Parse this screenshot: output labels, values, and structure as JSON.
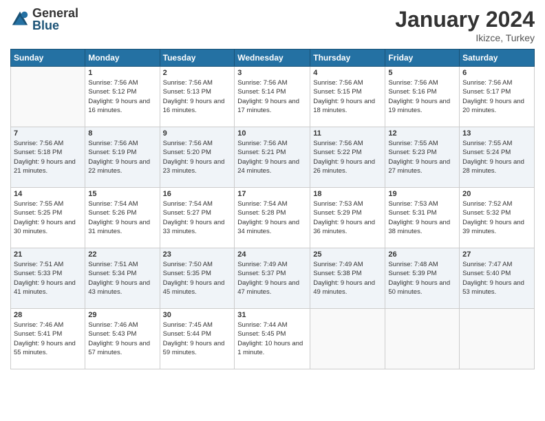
{
  "logo": {
    "general": "General",
    "blue": "Blue"
  },
  "header": {
    "title": "January 2024",
    "location": "Ikizce, Turkey"
  },
  "weekdays": [
    "Sunday",
    "Monday",
    "Tuesday",
    "Wednesday",
    "Thursday",
    "Friday",
    "Saturday"
  ],
  "weeks": [
    [
      {
        "day": "",
        "sunrise": "",
        "sunset": "",
        "daylight": ""
      },
      {
        "day": "1",
        "sunrise": "Sunrise: 7:56 AM",
        "sunset": "Sunset: 5:12 PM",
        "daylight": "Daylight: 9 hours and 16 minutes."
      },
      {
        "day": "2",
        "sunrise": "Sunrise: 7:56 AM",
        "sunset": "Sunset: 5:13 PM",
        "daylight": "Daylight: 9 hours and 16 minutes."
      },
      {
        "day": "3",
        "sunrise": "Sunrise: 7:56 AM",
        "sunset": "Sunset: 5:14 PM",
        "daylight": "Daylight: 9 hours and 17 minutes."
      },
      {
        "day": "4",
        "sunrise": "Sunrise: 7:56 AM",
        "sunset": "Sunset: 5:15 PM",
        "daylight": "Daylight: 9 hours and 18 minutes."
      },
      {
        "day": "5",
        "sunrise": "Sunrise: 7:56 AM",
        "sunset": "Sunset: 5:16 PM",
        "daylight": "Daylight: 9 hours and 19 minutes."
      },
      {
        "day": "6",
        "sunrise": "Sunrise: 7:56 AM",
        "sunset": "Sunset: 5:17 PM",
        "daylight": "Daylight: 9 hours and 20 minutes."
      }
    ],
    [
      {
        "day": "7",
        "sunrise": "Sunrise: 7:56 AM",
        "sunset": "Sunset: 5:18 PM",
        "daylight": "Daylight: 9 hours and 21 minutes."
      },
      {
        "day": "8",
        "sunrise": "Sunrise: 7:56 AM",
        "sunset": "Sunset: 5:19 PM",
        "daylight": "Daylight: 9 hours and 22 minutes."
      },
      {
        "day": "9",
        "sunrise": "Sunrise: 7:56 AM",
        "sunset": "Sunset: 5:20 PM",
        "daylight": "Daylight: 9 hours and 23 minutes."
      },
      {
        "day": "10",
        "sunrise": "Sunrise: 7:56 AM",
        "sunset": "Sunset: 5:21 PM",
        "daylight": "Daylight: 9 hours and 24 minutes."
      },
      {
        "day": "11",
        "sunrise": "Sunrise: 7:56 AM",
        "sunset": "Sunset: 5:22 PM",
        "daylight": "Daylight: 9 hours and 26 minutes."
      },
      {
        "day": "12",
        "sunrise": "Sunrise: 7:55 AM",
        "sunset": "Sunset: 5:23 PM",
        "daylight": "Daylight: 9 hours and 27 minutes."
      },
      {
        "day": "13",
        "sunrise": "Sunrise: 7:55 AM",
        "sunset": "Sunset: 5:24 PM",
        "daylight": "Daylight: 9 hours and 28 minutes."
      }
    ],
    [
      {
        "day": "14",
        "sunrise": "Sunrise: 7:55 AM",
        "sunset": "Sunset: 5:25 PM",
        "daylight": "Daylight: 9 hours and 30 minutes."
      },
      {
        "day": "15",
        "sunrise": "Sunrise: 7:54 AM",
        "sunset": "Sunset: 5:26 PM",
        "daylight": "Daylight: 9 hours and 31 minutes."
      },
      {
        "day": "16",
        "sunrise": "Sunrise: 7:54 AM",
        "sunset": "Sunset: 5:27 PM",
        "daylight": "Daylight: 9 hours and 33 minutes."
      },
      {
        "day": "17",
        "sunrise": "Sunrise: 7:54 AM",
        "sunset": "Sunset: 5:28 PM",
        "daylight": "Daylight: 9 hours and 34 minutes."
      },
      {
        "day": "18",
        "sunrise": "Sunrise: 7:53 AM",
        "sunset": "Sunset: 5:29 PM",
        "daylight": "Daylight: 9 hours and 36 minutes."
      },
      {
        "day": "19",
        "sunrise": "Sunrise: 7:53 AM",
        "sunset": "Sunset: 5:31 PM",
        "daylight": "Daylight: 9 hours and 38 minutes."
      },
      {
        "day": "20",
        "sunrise": "Sunrise: 7:52 AM",
        "sunset": "Sunset: 5:32 PM",
        "daylight": "Daylight: 9 hours and 39 minutes."
      }
    ],
    [
      {
        "day": "21",
        "sunrise": "Sunrise: 7:51 AM",
        "sunset": "Sunset: 5:33 PM",
        "daylight": "Daylight: 9 hours and 41 minutes."
      },
      {
        "day": "22",
        "sunrise": "Sunrise: 7:51 AM",
        "sunset": "Sunset: 5:34 PM",
        "daylight": "Daylight: 9 hours and 43 minutes."
      },
      {
        "day": "23",
        "sunrise": "Sunrise: 7:50 AM",
        "sunset": "Sunset: 5:35 PM",
        "daylight": "Daylight: 9 hours and 45 minutes."
      },
      {
        "day": "24",
        "sunrise": "Sunrise: 7:49 AM",
        "sunset": "Sunset: 5:37 PM",
        "daylight": "Daylight: 9 hours and 47 minutes."
      },
      {
        "day": "25",
        "sunrise": "Sunrise: 7:49 AM",
        "sunset": "Sunset: 5:38 PM",
        "daylight": "Daylight: 9 hours and 49 minutes."
      },
      {
        "day": "26",
        "sunrise": "Sunrise: 7:48 AM",
        "sunset": "Sunset: 5:39 PM",
        "daylight": "Daylight: 9 hours and 50 minutes."
      },
      {
        "day": "27",
        "sunrise": "Sunrise: 7:47 AM",
        "sunset": "Sunset: 5:40 PM",
        "daylight": "Daylight: 9 hours and 53 minutes."
      }
    ],
    [
      {
        "day": "28",
        "sunrise": "Sunrise: 7:46 AM",
        "sunset": "Sunset: 5:41 PM",
        "daylight": "Daylight: 9 hours and 55 minutes."
      },
      {
        "day": "29",
        "sunrise": "Sunrise: 7:46 AM",
        "sunset": "Sunset: 5:43 PM",
        "daylight": "Daylight: 9 hours and 57 minutes."
      },
      {
        "day": "30",
        "sunrise": "Sunrise: 7:45 AM",
        "sunset": "Sunset: 5:44 PM",
        "daylight": "Daylight: 9 hours and 59 minutes."
      },
      {
        "day": "31",
        "sunrise": "Sunrise: 7:44 AM",
        "sunset": "Sunset: 5:45 PM",
        "daylight": "Daylight: 10 hours and 1 minute."
      },
      {
        "day": "",
        "sunrise": "",
        "sunset": "",
        "daylight": ""
      },
      {
        "day": "",
        "sunrise": "",
        "sunset": "",
        "daylight": ""
      },
      {
        "day": "",
        "sunrise": "",
        "sunset": "",
        "daylight": ""
      }
    ]
  ]
}
